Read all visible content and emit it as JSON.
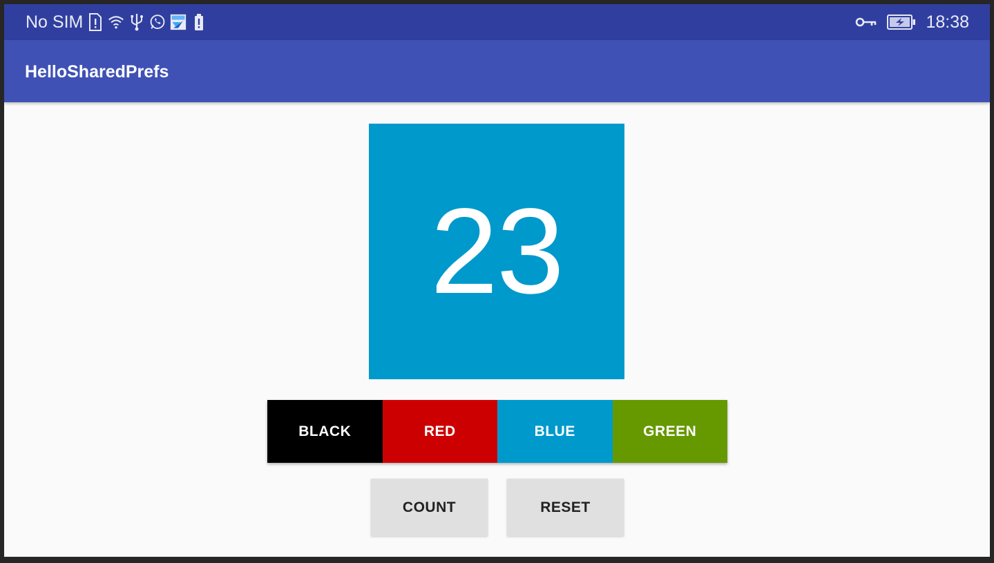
{
  "status_bar": {
    "carrier": "No SIM",
    "time": "18:38",
    "icons_left": [
      "sim-alert-icon",
      "wifi-icon",
      "usb-icon",
      "whatsapp-icon",
      "app-notification-icon",
      "battery-small-icon"
    ],
    "icons_right": [
      "vpn-key-icon",
      "battery-charging-icon"
    ]
  },
  "app_bar": {
    "title": "HelloSharedPrefs"
  },
  "counter": {
    "value": "23",
    "background_color": "#0099cc"
  },
  "color_buttons": [
    {
      "label": "BLACK",
      "color": "#000000"
    },
    {
      "label": "RED",
      "color": "#cc0000"
    },
    {
      "label": "BLUE",
      "color": "#0099cc"
    },
    {
      "label": "GREEN",
      "color": "#669900"
    }
  ],
  "actions": {
    "count_label": "COUNT",
    "reset_label": "RESET"
  },
  "colors": {
    "status_bar": "#303f9f",
    "app_bar": "#3f51b5",
    "button_gray": "#e0e0e0"
  }
}
